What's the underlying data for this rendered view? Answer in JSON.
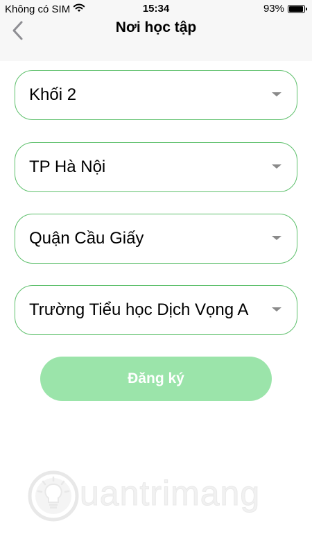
{
  "status_bar": {
    "carrier": "Không có SIM",
    "time": "15:34",
    "battery_percent": "93%",
    "battery_level": 0.93,
    "wifi_icon": "wifi-icon"
  },
  "nav": {
    "title": "Nơi học tập",
    "back_icon": "chevron-left-icon"
  },
  "form": {
    "grade": {
      "value": "Khối 2"
    },
    "city": {
      "value": "TP Hà Nội"
    },
    "district": {
      "value": "Quận Cầu Giấy"
    },
    "school": {
      "value": "Trường Tiểu học Dịch Vọng A"
    }
  },
  "register_button": {
    "label": "Đăng ký",
    "color": "#9be4aa"
  },
  "colors": {
    "field_border": "#5cbf6a",
    "caret": "#8a8a8a",
    "bar_background": "#f7f7f7"
  },
  "watermark": {
    "text": "uantrimang",
    "icon": "lightbulb-logo-icon"
  }
}
